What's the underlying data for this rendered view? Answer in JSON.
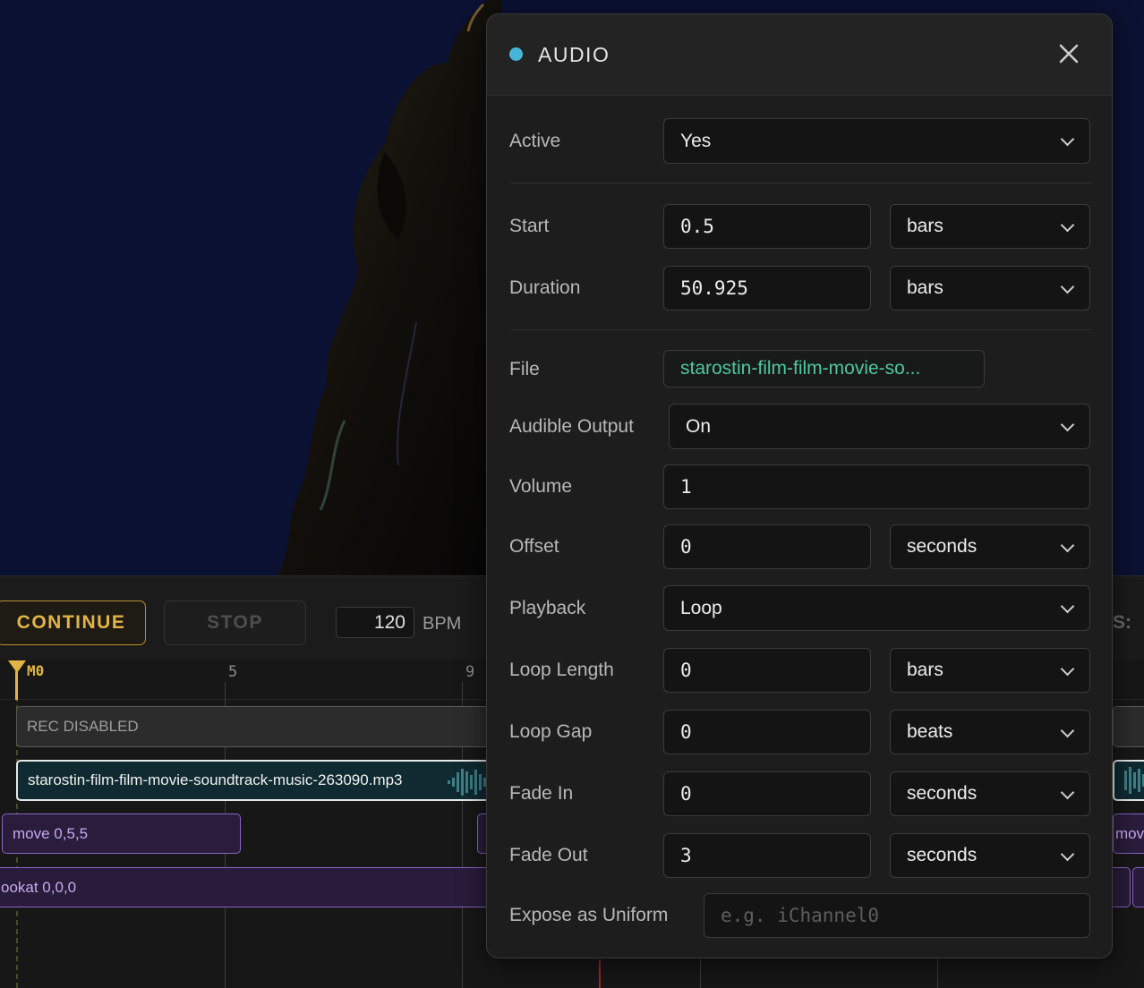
{
  "transport": {
    "continue_label": "CONTINUE",
    "stop_label": "STOP",
    "bpm_value": "120",
    "bpm_label": "BPM",
    "right_label": "S:"
  },
  "timeline": {
    "marker_label": "M0",
    "ticks": [
      "5",
      "9"
    ],
    "rec_label": "REC DISABLED",
    "audio_clip_label": "starostin-film-film-movie-soundtrack-music-263090.mp3",
    "move_label": "move  0,5,5",
    "move_right_label": "move",
    "lookat_label": "ookat 0,0,0"
  },
  "panel": {
    "title": "AUDIO",
    "accent_color": "#47b5d8",
    "close_icon": "close-icon",
    "fields": {
      "active": {
        "label": "Active",
        "value": "Yes"
      },
      "start": {
        "label": "Start",
        "value": "0.5",
        "unit": "bars"
      },
      "duration": {
        "label": "Duration",
        "value": "50.925",
        "unit": "bars"
      },
      "file": {
        "label": "File",
        "value": "starostin-film-film-movie-so..."
      },
      "audible_output": {
        "label": "Audible Output",
        "value": "On"
      },
      "volume": {
        "label": "Volume",
        "value": "1"
      },
      "offset": {
        "label": "Offset",
        "value": "0",
        "unit": "seconds"
      },
      "playback": {
        "label": "Playback",
        "value": "Loop"
      },
      "loop_length": {
        "label": "Loop Length",
        "value": "0",
        "unit": "bars"
      },
      "loop_gap": {
        "label": "Loop Gap",
        "value": "0",
        "unit": "beats"
      },
      "fade_in": {
        "label": "Fade In",
        "value": "0",
        "unit": "seconds"
      },
      "fade_out": {
        "label": "Fade Out",
        "value": "3",
        "unit": "seconds"
      },
      "expose_uniform": {
        "label": "Expose as Uniform",
        "placeholder": "e.g. iChannel0"
      }
    }
  }
}
